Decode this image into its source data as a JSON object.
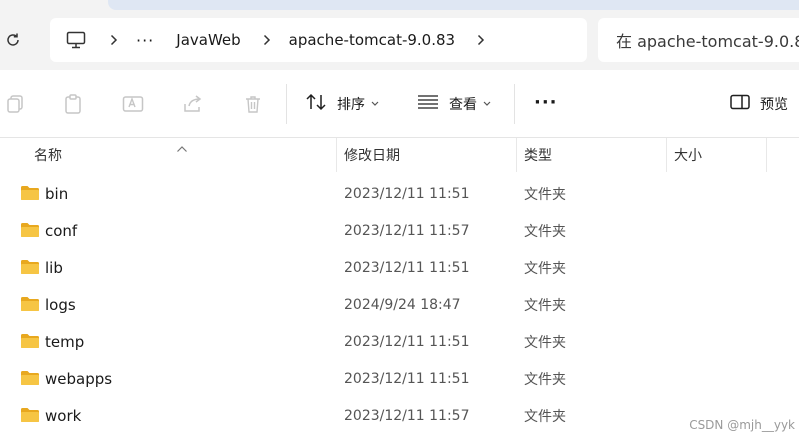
{
  "breadcrumb": {
    "overflow": "···",
    "items": [
      "JavaWeb",
      "apache-tomcat-9.0.83"
    ]
  },
  "search": {
    "text": "在 apache-tomcat-9.0.83"
  },
  "toolbar": {
    "sort_label": "排序",
    "view_label": "查看",
    "more_label": "···",
    "preview_label": "预览"
  },
  "columns": {
    "name": "名称",
    "date": "修改日期",
    "type": "类型",
    "size": "大小"
  },
  "files": [
    {
      "name": "bin",
      "date": "2023/12/11 11:51",
      "type": "文件夹"
    },
    {
      "name": "conf",
      "date": "2023/12/11 11:57",
      "type": "文件夹"
    },
    {
      "name": "lib",
      "date": "2023/12/11 11:51",
      "type": "文件夹"
    },
    {
      "name": "logs",
      "date": "2024/9/24 18:47",
      "type": "文件夹"
    },
    {
      "name": "temp",
      "date": "2023/12/11 11:51",
      "type": "文件夹"
    },
    {
      "name": "webapps",
      "date": "2023/12/11 11:51",
      "type": "文件夹"
    },
    {
      "name": "work",
      "date": "2023/12/11 11:57",
      "type": "文件夹"
    }
  ],
  "watermark": "CSDN @mjh__yyk",
  "colors": {
    "folder": "#f6c544",
    "folder_dark": "#e8a81f",
    "accent": "#1f6fd1"
  }
}
